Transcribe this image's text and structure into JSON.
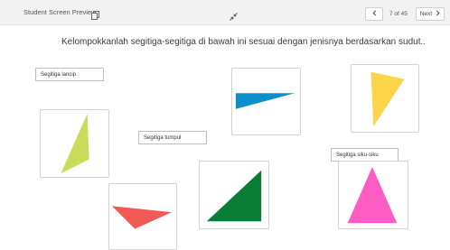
{
  "topbar": {
    "title": "Student Screen Preview",
    "copy_icon": "copy-icon",
    "expand_icon": "collapse-arrows-icon",
    "prev_icon": "chevron-left-icon",
    "page_indicator": "7 of 45",
    "next_label": "Next",
    "next_icon": "chevron-right-icon"
  },
  "question": {
    "instruction": "Kelompokkanlah segitiga-segitiga di bawah ini sesuai dengan jenisnya berdasarkan sudut.."
  },
  "labels": {
    "acute": "Segitiga lancip",
    "obtuse": "Segitiga tumpul",
    "right": "Segitiga siku-siku"
  },
  "colors": {
    "yellow_green": "#c8dc5a",
    "coral": "#f25a55",
    "blue": "#0a8fcb",
    "green": "#0a7d34",
    "yellow": "#fcd44a",
    "pink": "#ff5cc4"
  }
}
